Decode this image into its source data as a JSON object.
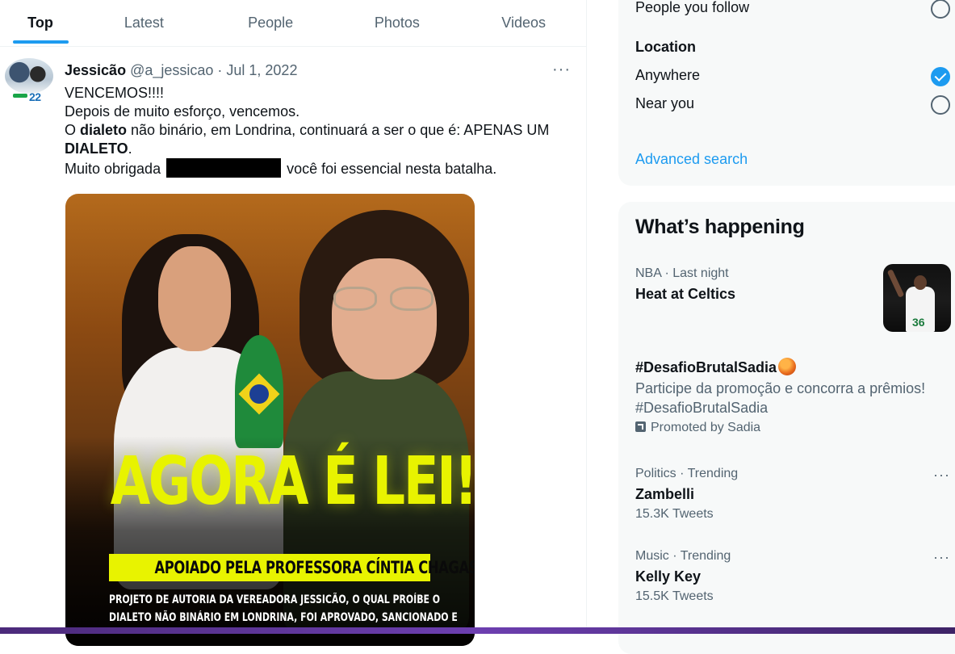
{
  "tabs": [
    "Top",
    "Latest",
    "People",
    "Photos",
    "Videos"
  ],
  "tweet": {
    "name": "Jessicão",
    "handle": "@a_jessicao",
    "date": "Jul 1, 2022",
    "meta": " @a_jessicao · Jul 1, 2022",
    "avatar_badge": "22",
    "lines": {
      "l1": "VENCEMOS!!!!",
      "l2": "Depois de muito esforço, vencemos.",
      "l3a": "O ",
      "l3b": "dialeto",
      "l3c": " não binário, em Londrina, continuará a ser o que é: APENAS UM",
      "l4a": "DIALETO",
      "l4b": ".",
      "l5a": "Muito obrigada ",
      "l5b": " você foi essencial nesta batalha."
    },
    "media": {
      "headline": "AGORA É LEI!",
      "subhead": "APOIADO PELA PROFESSORA CÍNTIA CHAGAS",
      "body1": "PROJETO DE AUTORIA DA VEREADORA JESSICÃO, O QUAL PROÍBE O",
      "body2": "DIALETO NÃO BINÁRIO EM LONDRINA, FOI APROVADO, SANCIONADO E"
    }
  },
  "search_filters": {
    "people_you_follow": "People you follow",
    "location_heading": "Location",
    "anywhere": "Anywhere",
    "near_you": "Near you",
    "advanced_search": "Advanced search",
    "selected_location": "Anywhere"
  },
  "trends": {
    "title": "What’s happening",
    "items": [
      {
        "context": "NBA · Last night",
        "topic": "Heat at Celtics"
      },
      {
        "topic": "#DesafioBrutalSadia",
        "description": "Participe da promoção e concorra a prêmios! #DesafioBrutalSadia",
        "promoted": "Promoted by Sadia"
      },
      {
        "context": "Politics · Trending",
        "topic": "Zambelli",
        "count": "15.3K Tweets"
      },
      {
        "context": "Music · Trending",
        "topic": "Kelly Key",
        "count": "15.5K Tweets"
      }
    ]
  },
  "colors": {
    "accent": "#1d9bf0",
    "text": "#0f1419",
    "muted": "#536471",
    "headline_yellow": "#e8f300"
  }
}
